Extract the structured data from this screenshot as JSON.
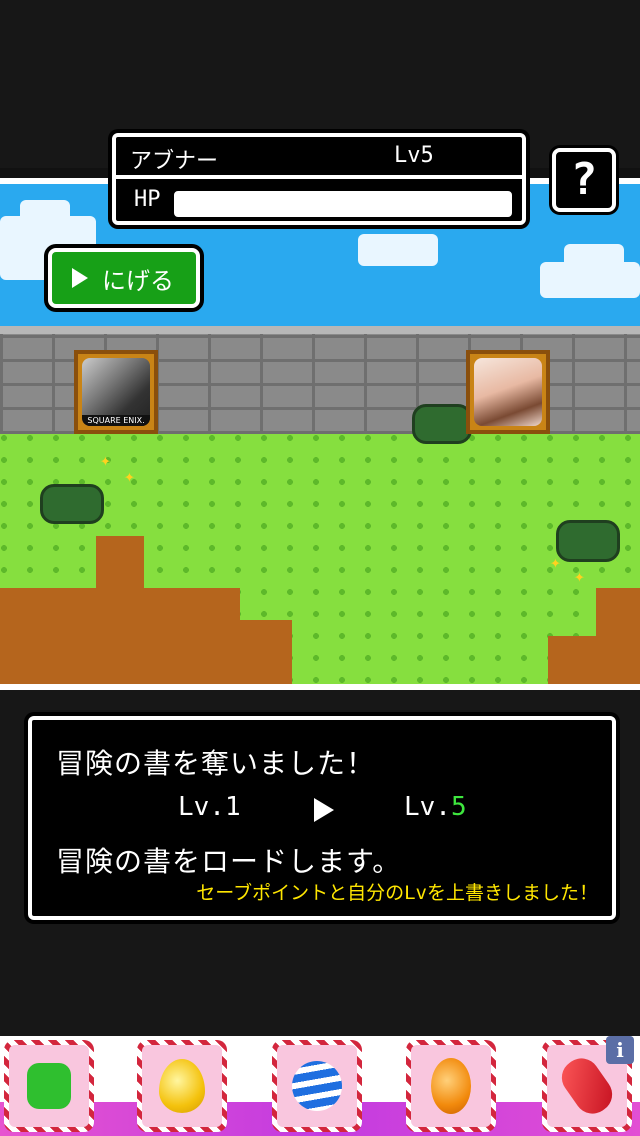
{
  "status": {
    "name": "アブナー",
    "level": "Lv5",
    "hp_label": "HP",
    "hp_fraction": 1.0
  },
  "help_button": {
    "label": "?"
  },
  "escape_button": {
    "label": "にげる"
  },
  "enemy": {
    "badge_text": "SQUARE ENIX."
  },
  "message": {
    "line1": "冒険の書を奪いました！",
    "lv_from": "Lv.1",
    "lv_to_prefix": "Lv.",
    "lv_to_value": "5",
    "line3": "冒険の書をロードします。",
    "note": "セーブポイントと自分のLvを上書きしました！"
  },
  "ad_bar": {
    "info_label": "i",
    "items": [
      "green-candy-icon",
      "yellow-drop-candy-icon",
      "blue-striped-candy-icon",
      "orange-candy-icon",
      "red-candy-icon"
    ]
  },
  "colors": {
    "escape_green": "#17a017",
    "level_highlight": "#3ee63e",
    "note_yellow": "#ffe600"
  }
}
